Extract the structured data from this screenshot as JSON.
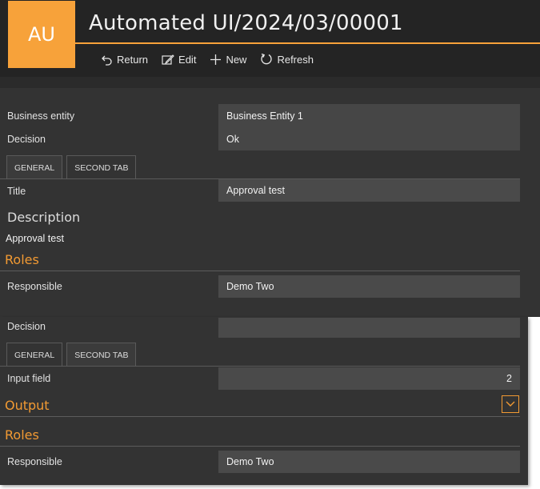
{
  "header": {
    "logo_text": "AU",
    "title": "Automated UI/2024/03/00001",
    "accent_color": "#f7a23a"
  },
  "toolbar": {
    "return_label": "Return",
    "edit_label": "Edit",
    "new_label": "New",
    "refresh_label": "Refresh"
  },
  "panel1": {
    "business_entity_label": "Business entity",
    "business_entity_value": "Business Entity 1",
    "decision_label": "Decision",
    "decision_value": "Ok",
    "tabs": [
      {
        "label": "GENERAL",
        "active": true
      },
      {
        "label": "SECOND TAB",
        "active": false
      }
    ],
    "title_label": "Title",
    "title_value": "Approval test",
    "description_heading": "Description",
    "description_text": "Approval test",
    "roles_heading": "Roles",
    "responsible_label": "Responsible",
    "responsible_value": "Demo Two"
  },
  "panel2": {
    "decision_label": "Decision",
    "decision_value": "",
    "tabs": [
      {
        "label": "GENERAL",
        "active": false
      },
      {
        "label": "SECOND TAB",
        "active": true
      }
    ],
    "input_field_label": "Input field",
    "input_field_value": "2",
    "output_heading": "Output",
    "roles_heading": "Roles",
    "responsible_label": "Responsible",
    "responsible_value": "Demo Two"
  },
  "icons": {
    "return": "return-arrow-icon",
    "edit": "edit-icon",
    "new": "plus-icon",
    "refresh": "refresh-icon",
    "collapse": "chevron-down-icon"
  }
}
